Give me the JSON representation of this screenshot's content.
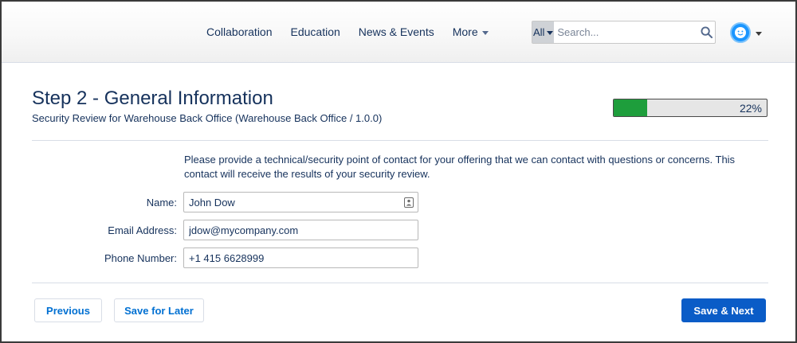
{
  "header": {
    "nav": [
      "Collaboration",
      "Education",
      "News & Events"
    ],
    "more_label": "More",
    "search": {
      "scope": "All",
      "placeholder": "Search..."
    }
  },
  "page": {
    "title": "Step 2 - General Information",
    "subtitle": "Security Review for Warehouse Back Office (Warehouse Back Office / 1.0.0)",
    "progress": {
      "percent": 22,
      "label": "22%",
      "fill_color": "#1e9e3c"
    },
    "intro": "Please provide a technical/security point of contact for your offering that we can contact with questions or concerns. This contact will receive the results of your security review."
  },
  "form": {
    "name": {
      "label": "Name:",
      "value": "John Dow"
    },
    "email": {
      "label": "Email Address:",
      "value": "jdow@mycompany.com"
    },
    "phone": {
      "label": "Phone Number:",
      "value": "+1 415 6628999"
    }
  },
  "actions": {
    "previous": "Previous",
    "save_later": "Save for Later",
    "save_next": "Save & Next"
  },
  "colors": {
    "brand": "#0a5cc7",
    "link": "#0070d2",
    "text": "#16325c",
    "success": "#1e9e3c"
  }
}
